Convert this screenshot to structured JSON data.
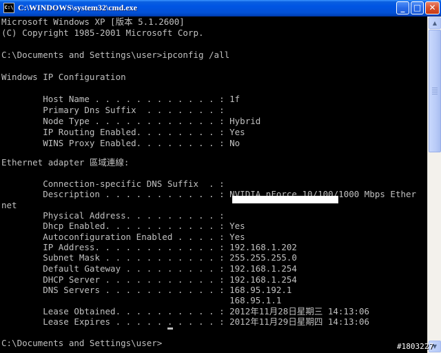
{
  "window": {
    "title": "C:\\WINDOWS\\system32\\cmd.exe",
    "icon_text": "C:\\",
    "minimize_glyph": "_",
    "maximize_glyph": "□",
    "close_glyph": "✕"
  },
  "console": {
    "lines": [
      "Microsoft Windows XP [版本 5.1.2600]",
      "(C) Copyright 1985-2001 Microsoft Corp.",
      "",
      "C:\\Documents and Settings\\user>ipconfig /all",
      "",
      "Windows IP Configuration",
      "",
      "        Host Name . . . . . . . . . . . . : 1f",
      "        Primary Dns Suffix  . . . . . . . :",
      "        Node Type . . . . . . . . . . . . : Hybrid",
      "        IP Routing Enabled. . . . . . . . : Yes",
      "        WINS Proxy Enabled. . . . . . . . : No",
      "",
      "Ethernet adapter 區域連線:",
      "",
      "        Connection-specific DNS Suffix  . :",
      "        Description . . . . . . . . . . . : NVIDIA nForce 10/100/1000 Mbps Ether",
      "net",
      "        Physical Address. . . . . . . . . :",
      "        Dhcp Enabled. . . . . . . . . . . : Yes",
      "        Autoconfiguration Enabled . . . . : Yes",
      "        IP Address. . . . . . . . . . . . : 192.168.1.202",
      "        Subnet Mask . . . . . . . . . . . : 255.255.255.0",
      "        Default Gateway . . . . . . . . . : 192.168.1.254",
      "        DHCP Server . . . . . . . . . . . : 192.168.1.254",
      "        DNS Servers . . . . . . . . . . . : 168.95.192.1",
      "                                            168.95.1.1",
      "        Lease Obtained. . . . . . . . . . : 2012年11月28日星期三 14:13:06",
      "        Lease Expires . . . . . . . . . . : 2012年11月29日星期四 14:13:06",
      "",
      "C:\\Documents and Settings\\user>"
    ]
  },
  "scrollbar": {
    "up_glyph": "▲",
    "down_glyph": "▼"
  },
  "watermark": {
    "text": "#1803227"
  },
  "colors": {
    "console_bg": "#000000",
    "console_text": "#c0c0c0",
    "titlebar_blue": "#0054e3",
    "close_red": "#d8512c"
  }
}
